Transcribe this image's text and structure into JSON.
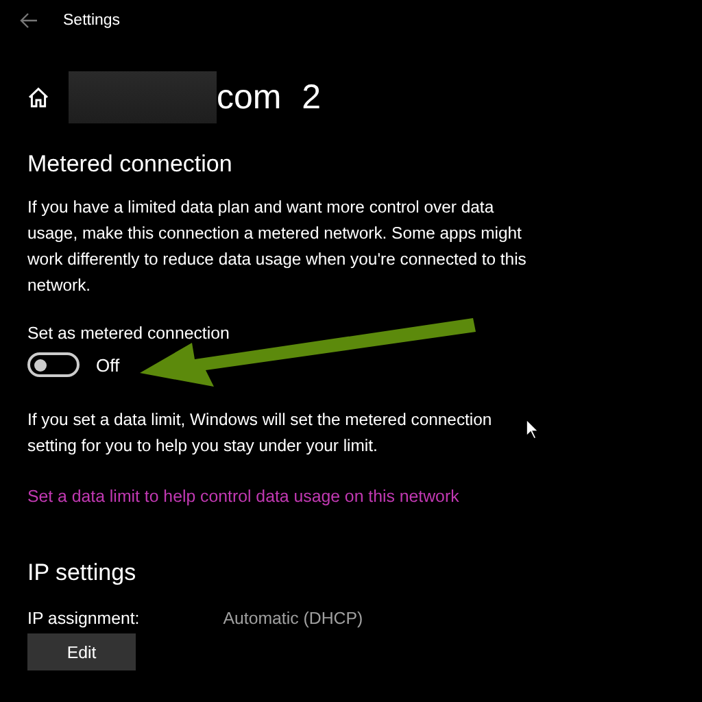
{
  "window": {
    "title": "Settings"
  },
  "header": {
    "title": "com 2"
  },
  "metered": {
    "heading": "Metered connection",
    "description": "If you have a limited data plan and want more control over data usage, make this connection a metered network. Some apps might work differently to reduce data usage when you're connected to this network.",
    "toggle": {
      "label": "Set as metered connection",
      "on": false,
      "state_text": "Off"
    },
    "limit_note": "If you set a data limit, Windows will set the metered connection setting for you to help you stay under your limit.",
    "link": "Set a data limit to help control data usage on this network"
  },
  "ip": {
    "heading": "IP settings",
    "assignment_label": "IP assignment:",
    "assignment_value": "Automatic (DHCP)",
    "button": "Edit"
  }
}
